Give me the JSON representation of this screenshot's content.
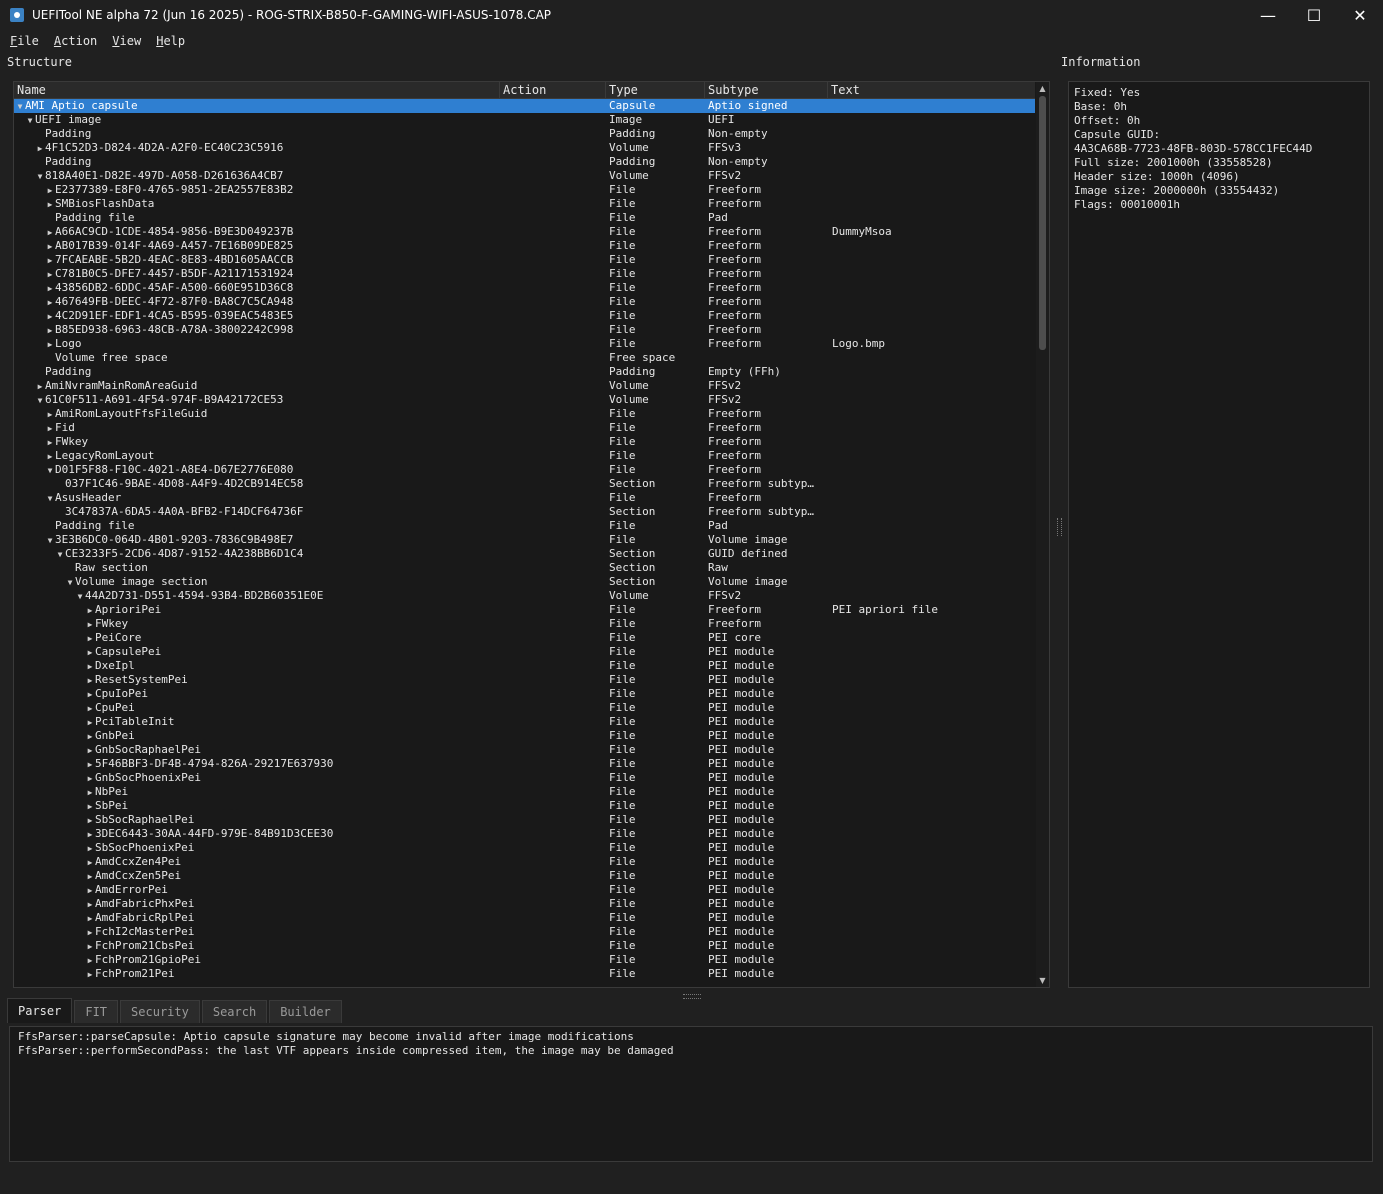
{
  "window": {
    "title": "UEFITool NE alpha 72 (Jun 16 2025) - ROG-STRIX-B850-F-GAMING-WIFI-ASUS-1078.CAP",
    "controls": {
      "minimize": "—",
      "maximize": "☐",
      "close": "✕"
    }
  },
  "menu": [
    {
      "u": "F",
      "rest": "ile"
    },
    {
      "u": "A",
      "rest": "ction"
    },
    {
      "u": "V",
      "rest": "iew"
    },
    {
      "u": "H",
      "rest": "elp"
    }
  ],
  "structure": {
    "label": "Structure",
    "columns": [
      "Name",
      "Action",
      "Type",
      "Subtype",
      "Text"
    ],
    "rows": [
      {
        "depth": 0,
        "arrow": "down",
        "name": "AMI Aptio capsule",
        "type": "Capsule",
        "subtype": "Aptio signed",
        "text": "",
        "selected": true
      },
      {
        "depth": 1,
        "arrow": "down",
        "name": "UEFI image",
        "type": "Image",
        "subtype": "UEFI",
        "text": ""
      },
      {
        "depth": 2,
        "arrow": "",
        "name": "Padding",
        "type": "Padding",
        "subtype": "Non-empty",
        "text": ""
      },
      {
        "depth": 2,
        "arrow": "right",
        "name": "4F1C52D3-D824-4D2A-A2F0-EC40C23C5916",
        "type": "Volume",
        "subtype": "FFSv3",
        "text": ""
      },
      {
        "depth": 2,
        "arrow": "",
        "name": "Padding",
        "type": "Padding",
        "subtype": "Non-empty",
        "text": ""
      },
      {
        "depth": 2,
        "arrow": "down",
        "name": "818A40E1-D82E-497D-A058-D261636A4CB7",
        "type": "Volume",
        "subtype": "FFSv2",
        "text": ""
      },
      {
        "depth": 3,
        "arrow": "right",
        "name": "E2377389-E8F0-4765-9851-2EA2557E83B2",
        "type": "File",
        "subtype": "Freeform",
        "text": ""
      },
      {
        "depth": 3,
        "arrow": "right",
        "name": "SMBiosFlashData",
        "type": "File",
        "subtype": "Freeform",
        "text": ""
      },
      {
        "depth": 3,
        "arrow": "",
        "name": "Padding file",
        "type": "File",
        "subtype": "Pad",
        "text": ""
      },
      {
        "depth": 3,
        "arrow": "right",
        "name": "A66AC9CD-1CDE-4854-9856-B9E3D049237B",
        "type": "File",
        "subtype": "Freeform",
        "text": "DummyMsoa"
      },
      {
        "depth": 3,
        "arrow": "right",
        "name": "AB017B39-014F-4A69-A457-7E16B09DE825",
        "type": "File",
        "subtype": "Freeform",
        "text": ""
      },
      {
        "depth": 3,
        "arrow": "right",
        "name": "7FCAEABE-5B2D-4EAC-8E83-4BD1605AACCB",
        "type": "File",
        "subtype": "Freeform",
        "text": ""
      },
      {
        "depth": 3,
        "arrow": "right",
        "name": "C781B0C5-DFE7-4457-B5DF-A21171531924",
        "type": "File",
        "subtype": "Freeform",
        "text": ""
      },
      {
        "depth": 3,
        "arrow": "right",
        "name": "43856DB2-6DDC-45AF-A500-660E951D36C8",
        "type": "File",
        "subtype": "Freeform",
        "text": ""
      },
      {
        "depth": 3,
        "arrow": "right",
        "name": "467649FB-DEEC-4F72-87F0-BA8C7C5CA948",
        "type": "File",
        "subtype": "Freeform",
        "text": ""
      },
      {
        "depth": 3,
        "arrow": "right",
        "name": "4C2D91EF-EDF1-4CA5-B595-039EAC5483E5",
        "type": "File",
        "subtype": "Freeform",
        "text": ""
      },
      {
        "depth": 3,
        "arrow": "right",
        "name": "B85ED938-6963-48CB-A78A-38002242C998",
        "type": "File",
        "subtype": "Freeform",
        "text": ""
      },
      {
        "depth": 3,
        "arrow": "right",
        "name": "Logo",
        "type": "File",
        "subtype": "Freeform",
        "text": "Logo.bmp"
      },
      {
        "depth": 3,
        "arrow": "",
        "name": "Volume free space",
        "type": "Free space",
        "subtype": "",
        "text": ""
      },
      {
        "depth": 2,
        "arrow": "",
        "name": "Padding",
        "type": "Padding",
        "subtype": "Empty (FFh)",
        "text": ""
      },
      {
        "depth": 2,
        "arrow": "right",
        "name": "AmiNvramMainRomAreaGuid",
        "type": "Volume",
        "subtype": "FFSv2",
        "text": ""
      },
      {
        "depth": 2,
        "arrow": "down",
        "name": "61C0F511-A691-4F54-974F-B9A42172CE53",
        "type": "Volume",
        "subtype": "FFSv2",
        "text": ""
      },
      {
        "depth": 3,
        "arrow": "right",
        "name": "AmiRomLayoutFfsFileGuid",
        "type": "File",
        "subtype": "Freeform",
        "text": ""
      },
      {
        "depth": 3,
        "arrow": "right",
        "name": "Fid",
        "type": "File",
        "subtype": "Freeform",
        "text": ""
      },
      {
        "depth": 3,
        "arrow": "right",
        "name": "FWkey",
        "type": "File",
        "subtype": "Freeform",
        "text": ""
      },
      {
        "depth": 3,
        "arrow": "right",
        "name": "LegacyRomLayout",
        "type": "File",
        "subtype": "Freeform",
        "text": ""
      },
      {
        "depth": 3,
        "arrow": "down",
        "name": "D01F5F88-F10C-4021-A8E4-D67E2776E080",
        "type": "File",
        "subtype": "Freeform",
        "text": ""
      },
      {
        "depth": 4,
        "arrow": "",
        "name": "037F1C46-9BAE-4D08-A4F9-4D2CB914EC58",
        "type": "Section",
        "subtype": "Freeform subtyp…",
        "text": ""
      },
      {
        "depth": 3,
        "arrow": "down",
        "name": "AsusHeader",
        "type": "File",
        "subtype": "Freeform",
        "text": ""
      },
      {
        "depth": 4,
        "arrow": "",
        "name": "3C47837A-6DA5-4A0A-BFB2-F14DCF64736F",
        "type": "Section",
        "subtype": "Freeform subtyp…",
        "text": ""
      },
      {
        "depth": 3,
        "arrow": "",
        "name": "Padding file",
        "type": "File",
        "subtype": "Pad",
        "text": ""
      },
      {
        "depth": 3,
        "arrow": "down",
        "name": "3E3B6DC0-064D-4B01-9203-7836C9B498E7",
        "type": "File",
        "subtype": "Volume image",
        "text": ""
      },
      {
        "depth": 4,
        "arrow": "down",
        "name": "CE3233F5-2CD6-4D87-9152-4A238BB6D1C4",
        "type": "Section",
        "subtype": "GUID defined",
        "text": ""
      },
      {
        "depth": 5,
        "arrow": "",
        "name": "Raw section",
        "type": "Section",
        "subtype": "Raw",
        "text": ""
      },
      {
        "depth": 5,
        "arrow": "down",
        "name": "Volume image section",
        "type": "Section",
        "subtype": "Volume image",
        "text": ""
      },
      {
        "depth": 6,
        "arrow": "down",
        "name": "44A2D731-D551-4594-93B4-BD2B60351E0E",
        "type": "Volume",
        "subtype": "FFSv2",
        "text": ""
      },
      {
        "depth": 7,
        "arrow": "right",
        "name": "AprioriPei",
        "type": "File",
        "subtype": "Freeform",
        "text": "PEI apriori file"
      },
      {
        "depth": 7,
        "arrow": "right",
        "name": "FWkey",
        "type": "File",
        "subtype": "Freeform",
        "text": ""
      },
      {
        "depth": 7,
        "arrow": "right",
        "name": "PeiCore",
        "type": "File",
        "subtype": "PEI core",
        "text": ""
      },
      {
        "depth": 7,
        "arrow": "right",
        "name": "CapsulePei",
        "type": "File",
        "subtype": "PEI module",
        "text": ""
      },
      {
        "depth": 7,
        "arrow": "right",
        "name": "DxeIpl",
        "type": "File",
        "subtype": "PEI module",
        "text": ""
      },
      {
        "depth": 7,
        "arrow": "right",
        "name": "ResetSystemPei",
        "type": "File",
        "subtype": "PEI module",
        "text": ""
      },
      {
        "depth": 7,
        "arrow": "right",
        "name": "CpuIoPei",
        "type": "File",
        "subtype": "PEI module",
        "text": ""
      },
      {
        "depth": 7,
        "arrow": "right",
        "name": "CpuPei",
        "type": "File",
        "subtype": "PEI module",
        "text": ""
      },
      {
        "depth": 7,
        "arrow": "right",
        "name": "PciTableInit",
        "type": "File",
        "subtype": "PEI module",
        "text": ""
      },
      {
        "depth": 7,
        "arrow": "right",
        "name": "GnbPei",
        "type": "File",
        "subtype": "PEI module",
        "text": ""
      },
      {
        "depth": 7,
        "arrow": "right",
        "name": "GnbSocRaphaelPei",
        "type": "File",
        "subtype": "PEI module",
        "text": ""
      },
      {
        "depth": 7,
        "arrow": "right",
        "name": "5F46BBF3-DF4B-4794-826A-29217E637930",
        "type": "File",
        "subtype": "PEI module",
        "text": ""
      },
      {
        "depth": 7,
        "arrow": "right",
        "name": "GnbSocPhoenixPei",
        "type": "File",
        "subtype": "PEI module",
        "text": ""
      },
      {
        "depth": 7,
        "arrow": "right",
        "name": "NbPei",
        "type": "File",
        "subtype": "PEI module",
        "text": ""
      },
      {
        "depth": 7,
        "arrow": "right",
        "name": "SbPei",
        "type": "File",
        "subtype": "PEI module",
        "text": ""
      },
      {
        "depth": 7,
        "arrow": "right",
        "name": "SbSocRaphaelPei",
        "type": "File",
        "subtype": "PEI module",
        "text": ""
      },
      {
        "depth": 7,
        "arrow": "right",
        "name": "3DEC6443-30AA-44FD-979E-84B91D3CEE30",
        "type": "File",
        "subtype": "PEI module",
        "text": ""
      },
      {
        "depth": 7,
        "arrow": "right",
        "name": "SbSocPhoenixPei",
        "type": "File",
        "subtype": "PEI module",
        "text": ""
      },
      {
        "depth": 7,
        "arrow": "right",
        "name": "AmdCcxZen4Pei",
        "type": "File",
        "subtype": "PEI module",
        "text": ""
      },
      {
        "depth": 7,
        "arrow": "right",
        "name": "AmdCcxZen5Pei",
        "type": "File",
        "subtype": "PEI module",
        "text": ""
      },
      {
        "depth": 7,
        "arrow": "right",
        "name": "AmdErrorPei",
        "type": "File",
        "subtype": "PEI module",
        "text": ""
      },
      {
        "depth": 7,
        "arrow": "right",
        "name": "AmdFabricPhxPei",
        "type": "File",
        "subtype": "PEI module",
        "text": ""
      },
      {
        "depth": 7,
        "arrow": "right",
        "name": "AmdFabricRplPei",
        "type": "File",
        "subtype": "PEI module",
        "text": ""
      },
      {
        "depth": 7,
        "arrow": "right",
        "name": "FchI2cMasterPei",
        "type": "File",
        "subtype": "PEI module",
        "text": ""
      },
      {
        "depth": 7,
        "arrow": "right",
        "name": "FchProm21CbsPei",
        "type": "File",
        "subtype": "PEI module",
        "text": ""
      },
      {
        "depth": 7,
        "arrow": "right",
        "name": "FchProm21GpioPei",
        "type": "File",
        "subtype": "PEI module",
        "text": ""
      },
      {
        "depth": 7,
        "arrow": "right",
        "name": "FchProm21Pei",
        "type": "File",
        "subtype": "PEI module",
        "text": ""
      }
    ]
  },
  "information": {
    "label": "Information",
    "lines": [
      "Fixed: Yes",
      "Base: 0h",
      "Offset: 0h",
      "Capsule GUID:",
      "4A3CA68B-7723-48FB-803D-578CC1FEC44D",
      "Full size: 2001000h (33558528)",
      "Header size: 1000h (4096)",
      "Image size: 2000000h (33554432)",
      "Flags: 00010001h"
    ]
  },
  "tabs": [
    "Parser",
    "FIT",
    "Security",
    "Search",
    "Builder"
  ],
  "active_tab": "Parser",
  "parser": {
    "messages": [
      "FfsParser::parseCapsule: Aptio capsule signature may become invalid after image modifications",
      "FfsParser::performSecondPass: the last VTF appears inside compressed item, the image may be damaged"
    ]
  },
  "colors": {
    "selection": "#2f7fd1",
    "background": "#202020",
    "panel": "#191919"
  }
}
